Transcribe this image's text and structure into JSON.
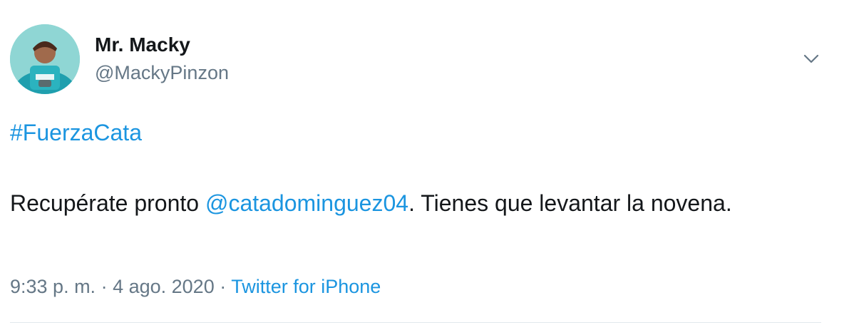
{
  "author": {
    "name": "Mr. Macky",
    "handle": "@MackyPinzon"
  },
  "tweet": {
    "hashtag": "#FuerzaCata",
    "text_before": "Recupérate pronto ",
    "mention": "@catadominguez04",
    "text_after": ". Tienes que levantar la novena."
  },
  "meta": {
    "time": "9:33 p. m.",
    "sep1": " · ",
    "date": "4 ago. 2020",
    "sep2": " · ",
    "source": "Twitter for iPhone"
  },
  "icons": {
    "menu": "chevron-down-icon"
  },
  "colors": {
    "link": "#1b95e0",
    "secondary_text": "#657786",
    "primary_text": "#14171a",
    "divider": "#e1e8ed"
  }
}
